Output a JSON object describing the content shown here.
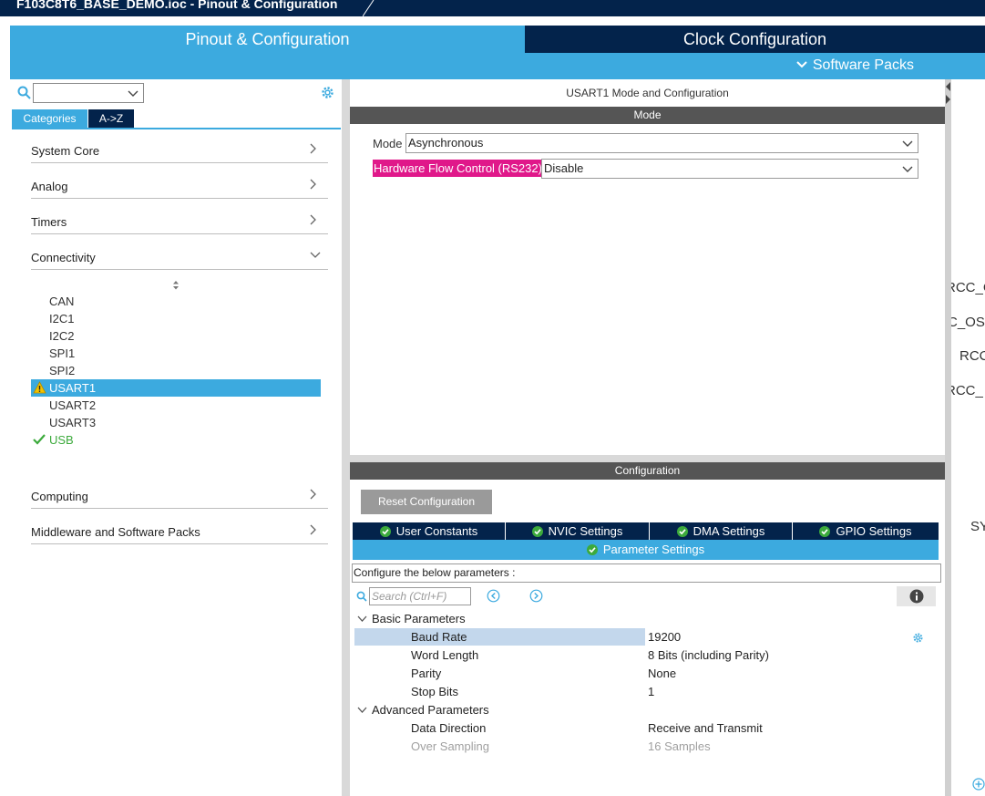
{
  "window": {
    "file_tab": "F103C8T6_BASE_DEMO.ioc - Pinout & Configuration"
  },
  "main_tabs": {
    "pinout": "Pinout & Configuration",
    "clock": "Clock Configuration",
    "software_packs": "Software Packs"
  },
  "left": {
    "search_value": "",
    "tabs": {
      "categories": "Categories",
      "az": "A->Z"
    },
    "categories": [
      {
        "label": "System Core"
      },
      {
        "label": "Analog"
      },
      {
        "label": "Timers"
      },
      {
        "label": "Connectivity"
      },
      {
        "label": "Computing"
      },
      {
        "label": "Middleware and Software Packs"
      }
    ],
    "connectivity_items": [
      {
        "label": "CAN",
        "status": "none"
      },
      {
        "label": "I2C1",
        "status": "none"
      },
      {
        "label": "I2C2",
        "status": "none"
      },
      {
        "label": "SPI1",
        "status": "none"
      },
      {
        "label": "SPI2",
        "status": "none"
      },
      {
        "label": "USART1",
        "status": "warning"
      },
      {
        "label": "USART2",
        "status": "none"
      },
      {
        "label": "USART3",
        "status": "none"
      },
      {
        "label": "USB",
        "status": "ok"
      }
    ]
  },
  "mode": {
    "title": "USART1 Mode and Configuration",
    "section": "Mode",
    "mode_label": "Mode",
    "mode_value": "Asynchronous",
    "hfc_label": "Hardware Flow Control (RS232)",
    "hfc_value": "Disable"
  },
  "config": {
    "section": "Configuration",
    "reset_button": "Reset Configuration",
    "tabs": [
      "User Constants",
      "NVIC Settings",
      "DMA Settings",
      "GPIO Settings"
    ],
    "active_tab": "Parameter Settings",
    "description": "Configure the below parameters :",
    "search_placeholder": "Search (Ctrl+F)",
    "groups": [
      {
        "name": "Basic Parameters",
        "params": [
          {
            "name": "Baud Rate",
            "value": "19200"
          },
          {
            "name": "Word Length",
            "value": "8 Bits (including Parity)"
          },
          {
            "name": "Parity",
            "value": "None"
          },
          {
            "name": "Stop Bits",
            "value": "1"
          }
        ]
      },
      {
        "name": "Advanced Parameters",
        "params": [
          {
            "name": "Data Direction",
            "value": "Receive and Transmit"
          },
          {
            "name": "Over Sampling",
            "value": "16 Samples"
          }
        ]
      }
    ]
  },
  "right_labels": [
    "RCC_C",
    "C_OS",
    "RCC",
    "RCC_",
    "SY"
  ],
  "colors": {
    "accent": "#3caadf",
    "dark": "#03234b",
    "highlight": "#e0188a",
    "ok": "#3caa3c",
    "warning": "#f2c200"
  }
}
